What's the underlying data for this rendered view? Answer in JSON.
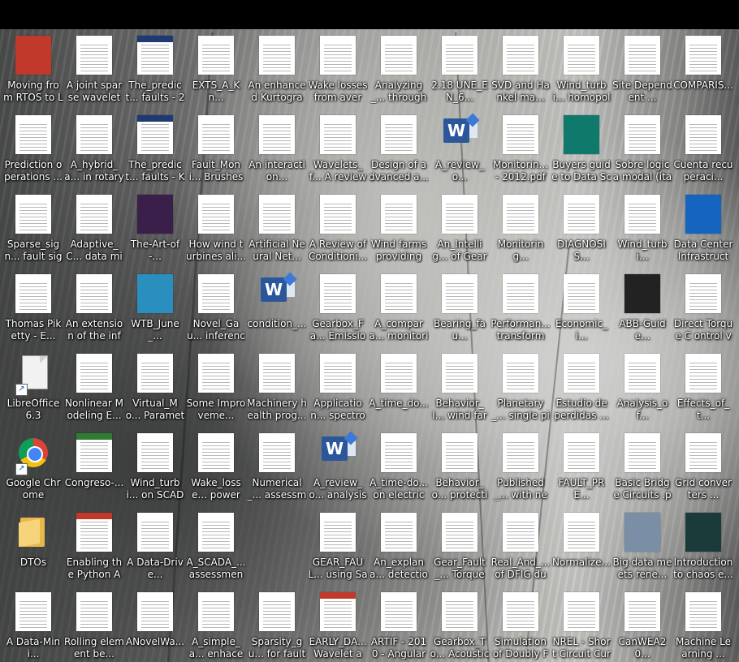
{
  "desktop": {
    "icons": [
      {
        "label": "Moving from RTOS to Lin...",
        "kind": "doc",
        "accent": "#c0392b",
        "cover": true
      },
      {
        "label": "A joint sparse wavelet coe...",
        "kind": "doc"
      },
      {
        "label": "The_predict... faults - 201...",
        "kind": "doc",
        "accent": "#1f3a73"
      },
      {
        "label": "EXTS_A_Kn...",
        "kind": "doc"
      },
      {
        "label": "An enhanced Kurtogram ...",
        "kind": "doc"
      },
      {
        "label": "Wake losses from avera...",
        "kind": "doc"
      },
      {
        "label": "Analyzing_... through vib...",
        "kind": "doc"
      },
      {
        "label": "2.18 UNE_EN_6...",
        "kind": "doc"
      },
      {
        "label": "SVD and Hankel ma...",
        "kind": "doc"
      },
      {
        "label": "Wind_turbi... homopolar ...",
        "kind": "doc"
      },
      {
        "label": "Site Dependent ...",
        "kind": "doc"
      },
      {
        "label": "COMPARIS...",
        "kind": "doc"
      },
      {
        "label": "Prediction operations ...",
        "kind": "doc"
      },
      {
        "label": "A_hybrid_a... in rotary m...",
        "kind": "doc"
      },
      {
        "label": "The_predict... faults - Kusi...",
        "kind": "doc",
        "accent": "#1f3a73"
      },
      {
        "label": "Fault_Moni... Brushes - K...",
        "kind": "doc"
      },
      {
        "label": "An interaction...",
        "kind": "doc"
      },
      {
        "label": "Wavelets_f... A review - 2...",
        "kind": "doc"
      },
      {
        "label": "Design of advanced a...",
        "kind": "doc"
      },
      {
        "label": "A_review_o...",
        "kind": "word"
      },
      {
        "label": "Monitorin... - 2012.pdf",
        "kind": "doc"
      },
      {
        "label": "Buyers guide to Data Sci...",
        "kind": "doc",
        "accent": "#0f7a6b",
        "cover": true
      },
      {
        "label": "Sobre logica modal (ital...",
        "kind": "doc"
      },
      {
        "label": "Cuenta recuperaci...",
        "kind": "doc"
      },
      {
        "label": "Sparse_sign... fault signal...",
        "kind": "doc"
      },
      {
        "label": "Adaptive_C... data minig ...",
        "kind": "doc"
      },
      {
        "label": "The-Art-of-...",
        "kind": "doc",
        "accent": "#3a1f4a",
        "cover": true
      },
      {
        "label": "How wind turbines ali...",
        "kind": "doc"
      },
      {
        "label": "Artificial Neural Net...",
        "kind": "doc"
      },
      {
        "label": "A Review of Conditioni...",
        "kind": "doc"
      },
      {
        "label": "Wind farms providing s...",
        "kind": "doc"
      },
      {
        "label": "An_Intellig... of Gearbox...",
        "kind": "doc"
      },
      {
        "label": "Monitoring...",
        "kind": "doc"
      },
      {
        "label": "DIAGNOSIS...",
        "kind": "doc"
      },
      {
        "label": "Wind_turbi...",
        "kind": "doc"
      },
      {
        "label": "Data Center Infrastructu...",
        "kind": "doc",
        "accent": "#1565c0",
        "cover": true
      },
      {
        "label": "Thomas Piketty - E...",
        "kind": "doc"
      },
      {
        "label": "An extension of the info...",
        "kind": "doc"
      },
      {
        "label": "WTB_June_...",
        "kind": "doc",
        "accent": "#2a8fbf",
        "cover": true
      },
      {
        "label": "Novel_Gau... inference ...",
        "kind": "doc"
      },
      {
        "label": "condition_...",
        "kind": "word"
      },
      {
        "label": "Gearbox_Fa... Emissio Sen...",
        "kind": "doc"
      },
      {
        "label": "A_compara... monitoring...",
        "kind": "doc"
      },
      {
        "label": "Bearing_fau...",
        "kind": "doc"
      },
      {
        "label": "Performan... transform ...",
        "kind": "doc"
      },
      {
        "label": "Economic_i...",
        "kind": "doc"
      },
      {
        "label": "ABB-Guide...",
        "kind": "doc",
        "accent": "#222222",
        "cover": true
      },
      {
        "label": "Direct Torque C ontrol vs...",
        "kind": "doc"
      },
      {
        "label": "LibreOffice 6.3",
        "kind": "libreoffice"
      },
      {
        "label": "Nonlinear Modeling E...",
        "kind": "doc"
      },
      {
        "label": "Virtual_Mo... Parameters ...",
        "kind": "doc"
      },
      {
        "label": "Some Improveme...",
        "kind": "doc"
      },
      {
        "label": "Machinery health prog...",
        "kind": "doc"
      },
      {
        "label": "Application... spectrogra...",
        "kind": "doc"
      },
      {
        "label": "A_time_do...",
        "kind": "doc"
      },
      {
        "label": "Behavior_I... wind farms...",
        "kind": "doc"
      },
      {
        "label": "Planetary_... single piez...",
        "kind": "doc"
      },
      {
        "label": "Estudio de perdidas ...",
        "kind": "doc"
      },
      {
        "label": "Analysis_of...",
        "kind": "doc"
      },
      {
        "label": "Effects_of_t...",
        "kind": "doc"
      },
      {
        "label": "Google Chrome",
        "kind": "chrome"
      },
      {
        "label": "Congreso-...",
        "kind": "doc",
        "accent": "#2e7d32"
      },
      {
        "label": "Wind_turbi... on SCADA ...",
        "kind": "doc"
      },
      {
        "label": "Wake_losse... power mea...",
        "kind": "doc"
      },
      {
        "label": "Numerical_... assessmen...",
        "kind": "doc"
      },
      {
        "label": "A_review_o... analysis WT...",
        "kind": "word"
      },
      {
        "label": "A_time-do... on electrica...",
        "kind": "doc"
      },
      {
        "label": "Behavior_o... protection ...",
        "kind": "doc"
      },
      {
        "label": "Published_... with new r...",
        "kind": "doc"
      },
      {
        "label": "FAULT_PRE...",
        "kind": "doc"
      },
      {
        "label": "Basic Bridge Circuits .pdf",
        "kind": "doc"
      },
      {
        "label": "Grid converters ...",
        "kind": "doc"
      },
      {
        "label": "DTOs",
        "kind": "folder"
      },
      {
        "label": "Enabling the Python AP...",
        "kind": "doc",
        "accent": "#c0392b"
      },
      {
        "label": "A Data-Drive...",
        "kind": "doc"
      },
      {
        "label": "A_SCADA_... assessment...",
        "kind": "doc"
      },
      {
        "label": "",
        "kind": "none"
      },
      {
        "label": "GEAR_FAUL... using Satat...",
        "kind": "doc"
      },
      {
        "label": "An_explana... detection o...",
        "kind": "doc"
      },
      {
        "label": "Gear_Fault_... Torque Gea...",
        "kind": "doc"
      },
      {
        "label": "Real_And_... of DFIG dur...",
        "kind": "doc"
      },
      {
        "label": "Normalize...",
        "kind": "doc"
      },
      {
        "label": "Big data meets rene...",
        "kind": "doc",
        "accent": "#7a8fa6",
        "cover": true
      },
      {
        "label": "Introduction to chaos e...",
        "kind": "doc",
        "accent": "#1b3b3b",
        "cover": true
      },
      {
        "label": "A Data-Mini...",
        "kind": "doc"
      },
      {
        "label": "Rolling element be...",
        "kind": "doc"
      },
      {
        "label": "ANovelWa...",
        "kind": "doc"
      },
      {
        "label": "A_simple_a... enhaced-sq...",
        "kind": "doc"
      },
      {
        "label": "Sparsity_gu... for fault dia...",
        "kind": "doc"
      },
      {
        "label": "EARLY_DA... Wavelet an...",
        "kind": "doc",
        "accent": "#c0392b"
      },
      {
        "label": "ARTIF - 2010 - Angular r...",
        "kind": "doc"
      },
      {
        "label": "Gearbox_To... Acoustic e...",
        "kind": "doc"
      },
      {
        "label": "Simulation of Doubly Fed...",
        "kind": "doc"
      },
      {
        "label": "NREL - Short Circuit Curr...",
        "kind": "doc"
      },
      {
        "label": "CanWEA20...",
        "kind": "doc"
      },
      {
        "label": "Machine Learning ...",
        "kind": "doc"
      }
    ]
  }
}
